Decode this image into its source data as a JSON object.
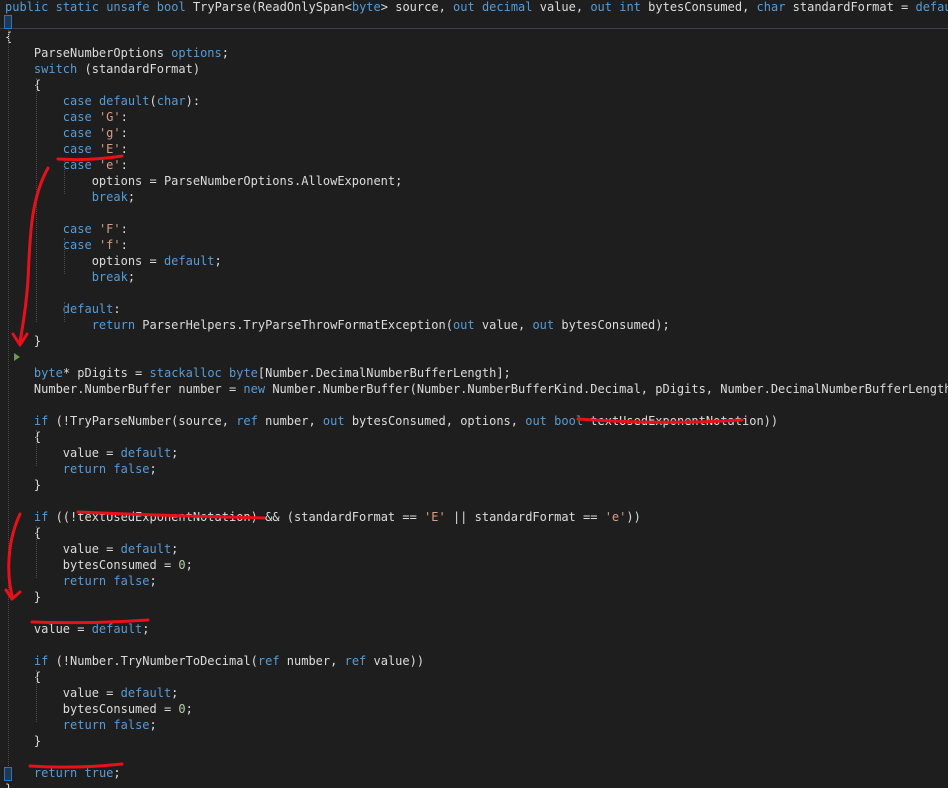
{
  "editor": {
    "lines": [
      {
        "tokens": [
          [
            "kw",
            "public"
          ],
          [
            "id",
            " "
          ],
          [
            "kw",
            "static"
          ],
          [
            "id",
            " "
          ],
          [
            "kw",
            "unsafe"
          ],
          [
            "id",
            " "
          ],
          [
            "kw",
            "bool"
          ],
          [
            "id",
            " TryParse(ReadOnlySpan<"
          ],
          [
            "kw",
            "byte"
          ],
          [
            "id",
            "> source, "
          ],
          [
            "kw",
            "out"
          ],
          [
            "id",
            " "
          ],
          [
            "kw",
            "decimal"
          ],
          [
            "id",
            " value, "
          ],
          [
            "kw",
            "out"
          ],
          [
            "id",
            " "
          ],
          [
            "kw",
            "int"
          ],
          [
            "id",
            " bytesConsumed, "
          ],
          [
            "kw",
            "char"
          ],
          [
            "id",
            " standardFormat = "
          ],
          [
            "kw",
            "default"
          ],
          [
            "id",
            ")"
          ]
        ]
      },
      {
        "tokens": [
          [
            "id",
            "{"
          ]
        ]
      },
      {
        "tokens": [
          [
            "id",
            "    ParseNumberOptions "
          ],
          [
            "kw",
            "options"
          ],
          [
            "id",
            ";"
          ]
        ]
      },
      {
        "tokens": [
          [
            "id",
            "    "
          ],
          [
            "kw",
            "switch"
          ],
          [
            "id",
            " (standardFormat)"
          ]
        ]
      },
      {
        "tokens": [
          [
            "id",
            "    {"
          ]
        ]
      },
      {
        "tokens": [
          [
            "id",
            "        "
          ],
          [
            "kw",
            "case"
          ],
          [
            "id",
            " "
          ],
          [
            "kw",
            "default"
          ],
          [
            "id",
            "("
          ],
          [
            "kw",
            "char"
          ],
          [
            "id",
            "):"
          ]
        ]
      },
      {
        "tokens": [
          [
            "id",
            "        "
          ],
          [
            "kw",
            "case"
          ],
          [
            "id",
            " "
          ],
          [
            "str",
            "'G'"
          ],
          [
            "id",
            ":"
          ]
        ]
      },
      {
        "tokens": [
          [
            "id",
            "        "
          ],
          [
            "kw",
            "case"
          ],
          [
            "id",
            " "
          ],
          [
            "str",
            "'g'"
          ],
          [
            "id",
            ":"
          ]
        ]
      },
      {
        "tokens": [
          [
            "id",
            "        "
          ],
          [
            "kw",
            "case"
          ],
          [
            "id",
            " "
          ],
          [
            "str",
            "'E'"
          ],
          [
            "id",
            ":"
          ]
        ]
      },
      {
        "tokens": [
          [
            "id",
            "        "
          ],
          [
            "kw",
            "case"
          ],
          [
            "id",
            " "
          ],
          [
            "str",
            "'e'"
          ],
          [
            "id",
            ":"
          ]
        ]
      },
      {
        "tokens": [
          [
            "id",
            "            options = ParseNumberOptions.AllowExponent;"
          ]
        ]
      },
      {
        "tokens": [
          [
            "id",
            "            "
          ],
          [
            "kw",
            "break"
          ],
          [
            "id",
            ";"
          ]
        ]
      },
      {
        "tokens": []
      },
      {
        "tokens": [
          [
            "id",
            "        "
          ],
          [
            "kw",
            "case"
          ],
          [
            "id",
            " "
          ],
          [
            "str",
            "'F'"
          ],
          [
            "id",
            ":"
          ]
        ]
      },
      {
        "tokens": [
          [
            "id",
            "        "
          ],
          [
            "kw",
            "case"
          ],
          [
            "id",
            " "
          ],
          [
            "str",
            "'f'"
          ],
          [
            "id",
            ":"
          ]
        ]
      },
      {
        "tokens": [
          [
            "id",
            "            options = "
          ],
          [
            "kw",
            "default"
          ],
          [
            "id",
            ";"
          ]
        ]
      },
      {
        "tokens": [
          [
            "id",
            "            "
          ],
          [
            "kw",
            "break"
          ],
          [
            "id",
            ";"
          ]
        ]
      },
      {
        "tokens": []
      },
      {
        "tokens": [
          [
            "id",
            "        "
          ],
          [
            "kw",
            "default"
          ],
          [
            "id",
            ":"
          ]
        ]
      },
      {
        "tokens": [
          [
            "id",
            "            "
          ],
          [
            "kw",
            "return"
          ],
          [
            "id",
            " ParserHelpers.TryParseThrowFormatException("
          ],
          [
            "kw",
            "out"
          ],
          [
            "id",
            " value, "
          ],
          [
            "kw",
            "out"
          ],
          [
            "id",
            " bytesConsumed);"
          ]
        ]
      },
      {
        "tokens": [
          [
            "id",
            "    }"
          ]
        ]
      },
      {
        "tokens": []
      },
      {
        "tokens": [
          [
            "id",
            "    "
          ],
          [
            "kw",
            "byte"
          ],
          [
            "id",
            "* pDigits = "
          ],
          [
            "kw",
            "stackalloc"
          ],
          [
            "id",
            " "
          ],
          [
            "kw",
            "byte"
          ],
          [
            "id",
            "[Number.DecimalNumberBufferLength];"
          ]
        ]
      },
      {
        "tokens": [
          [
            "id",
            "    Number.NumberBuffer number = "
          ],
          [
            "kw",
            "new"
          ],
          [
            "id",
            " Number.NumberBuffer(Number.NumberBufferKind.Decimal, pDigits, Number.DecimalNumberBufferLength);"
          ]
        ]
      },
      {
        "tokens": []
      },
      {
        "tokens": [
          [
            "id",
            "    "
          ],
          [
            "kw",
            "if"
          ],
          [
            "id",
            " (!TryParseNumber(source, "
          ],
          [
            "kw",
            "ref"
          ],
          [
            "id",
            " number, "
          ],
          [
            "kw",
            "out"
          ],
          [
            "id",
            " bytesConsumed, options, "
          ],
          [
            "kw",
            "out"
          ],
          [
            "id",
            " "
          ],
          [
            "kw",
            "bool"
          ],
          [
            "id",
            " textUsedExponentNotation))"
          ]
        ]
      },
      {
        "tokens": [
          [
            "id",
            "    {"
          ]
        ]
      },
      {
        "tokens": [
          [
            "id",
            "        value = "
          ],
          [
            "kw",
            "default"
          ],
          [
            "id",
            ";"
          ]
        ]
      },
      {
        "tokens": [
          [
            "id",
            "        "
          ],
          [
            "kw",
            "return"
          ],
          [
            "id",
            " "
          ],
          [
            "kw",
            "false"
          ],
          [
            "id",
            ";"
          ]
        ]
      },
      {
        "tokens": [
          [
            "id",
            "    }"
          ]
        ]
      },
      {
        "tokens": []
      },
      {
        "tokens": [
          [
            "id",
            "    "
          ],
          [
            "kw",
            "if"
          ],
          [
            "id",
            " ((!textUsedExponentNotation) && (standardFormat == "
          ],
          [
            "str",
            "'E'"
          ],
          [
            "id",
            " || standardFormat == "
          ],
          [
            "str",
            "'e'"
          ],
          [
            "id",
            "))"
          ]
        ]
      },
      {
        "tokens": [
          [
            "id",
            "    {"
          ]
        ]
      },
      {
        "tokens": [
          [
            "id",
            "        value = "
          ],
          [
            "kw",
            "default"
          ],
          [
            "id",
            ";"
          ]
        ]
      },
      {
        "tokens": [
          [
            "id",
            "        bytesConsumed = "
          ],
          [
            "num",
            "0"
          ],
          [
            "id",
            ";"
          ]
        ]
      },
      {
        "tokens": [
          [
            "id",
            "        "
          ],
          [
            "kw",
            "return"
          ],
          [
            "id",
            " "
          ],
          [
            "kw",
            "false"
          ],
          [
            "id",
            ";"
          ]
        ]
      },
      {
        "tokens": [
          [
            "id",
            "    }"
          ]
        ]
      },
      {
        "tokens": []
      },
      {
        "tokens": [
          [
            "id",
            "    value = "
          ],
          [
            "kw",
            "default"
          ],
          [
            "id",
            ";"
          ]
        ]
      },
      {
        "tokens": []
      },
      {
        "tokens": [
          [
            "id",
            "    "
          ],
          [
            "kw",
            "if"
          ],
          [
            "id",
            " (!Number.TryNumberToDecimal("
          ],
          [
            "kw",
            "ref"
          ],
          [
            "id",
            " number, "
          ],
          [
            "kw",
            "ref"
          ],
          [
            "id",
            " value))"
          ]
        ]
      },
      {
        "tokens": [
          [
            "id",
            "    {"
          ]
        ]
      },
      {
        "tokens": [
          [
            "id",
            "        value = "
          ],
          [
            "kw",
            "default"
          ],
          [
            "id",
            ";"
          ]
        ]
      },
      {
        "tokens": [
          [
            "id",
            "        bytesConsumed = "
          ],
          [
            "num",
            "0"
          ],
          [
            "id",
            ";"
          ]
        ]
      },
      {
        "tokens": [
          [
            "id",
            "        "
          ],
          [
            "kw",
            "return"
          ],
          [
            "id",
            " "
          ],
          [
            "kw",
            "false"
          ],
          [
            "id",
            ";"
          ]
        ]
      },
      {
        "tokens": [
          [
            "id",
            "    }"
          ]
        ]
      },
      {
        "tokens": []
      },
      {
        "tokens": [
          [
            "id",
            "    "
          ],
          [
            "kw",
            "return"
          ],
          [
            "id",
            " "
          ],
          [
            "kw",
            "true"
          ],
          [
            "id",
            ";"
          ]
        ]
      },
      {
        "tokens": [
          [
            "id",
            "}"
          ]
        ]
      }
    ]
  },
  "colors": {
    "background": "#1e1e1e",
    "keyword": "#569cd6",
    "string": "#d69d85",
    "number": "#b5cea8",
    "text": "#dcdcdc",
    "annotation": "#e8101a",
    "exec_marker": "#6a9955"
  },
  "icons": {
    "exec_marker": "execution-pointer-icon"
  }
}
